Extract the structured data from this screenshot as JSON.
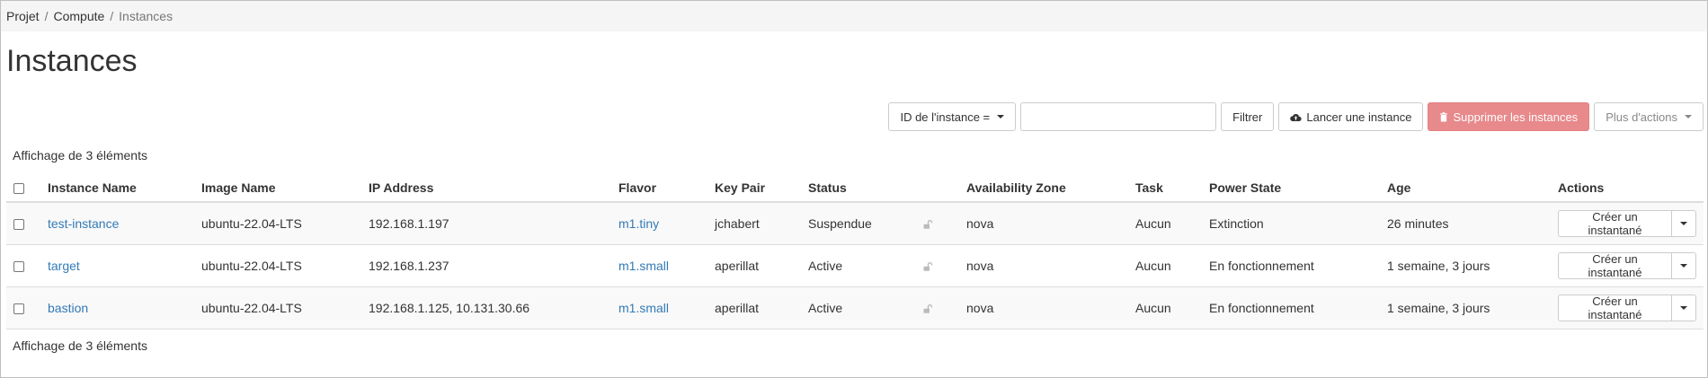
{
  "breadcrumb": {
    "items": [
      "Projet",
      "Compute",
      "Instances"
    ],
    "separator": "/"
  },
  "page_title": "Instances",
  "toolbar": {
    "filter_field_label": "ID de l'instance =",
    "filter_input_value": "",
    "filter_button": "Filtrer",
    "launch_button": "Lancer une instance",
    "delete_button": "Supprimer les instances",
    "more_actions_button": "Plus d'actions"
  },
  "table": {
    "count_label": "Affichage de 3 éléments",
    "columns": [
      "Instance Name",
      "Image Name",
      "IP Address",
      "Flavor",
      "Key Pair",
      "Status",
      "",
      "Availability Zone",
      "Task",
      "Power State",
      "Age",
      "Actions"
    ],
    "rows": [
      {
        "name": "test-instance",
        "image": "ubuntu-22.04-LTS",
        "ip": "192.168.1.197",
        "flavor": "m1.tiny",
        "keypair": "jchabert",
        "status": "Suspendue",
        "zone": "nova",
        "task": "Aucun",
        "power": "Extinction",
        "age": "26 minutes",
        "action": "Créer un instantané"
      },
      {
        "name": "target",
        "image": "ubuntu-22.04-LTS",
        "ip": "192.168.1.237",
        "flavor": "m1.small",
        "keypair": "aperillat",
        "status": "Active",
        "zone": "nova",
        "task": "Aucun",
        "power": "En fonctionnement",
        "age": "1 semaine, 3 jours",
        "action": "Créer un instantané"
      },
      {
        "name": "bastion",
        "image": "ubuntu-22.04-LTS",
        "ip": "192.168.1.125, 10.131.30.66",
        "flavor": "m1.small",
        "keypair": "aperillat",
        "status": "Active",
        "zone": "nova",
        "task": "Aucun",
        "power": "En fonctionnement",
        "age": "1 semaine, 3 jours",
        "action": "Créer un instantané"
      }
    ]
  },
  "icons": {
    "launch": "cloud-upload-icon",
    "delete": "trash-icon",
    "lock": "unlocked-icon",
    "caret": "caret-down-icon"
  },
  "colors": {
    "link": "#337ab7",
    "danger": "#e8898b",
    "breadcrumb_bg": "#f5f5f5",
    "row_stripe": "#f9f9f9"
  }
}
